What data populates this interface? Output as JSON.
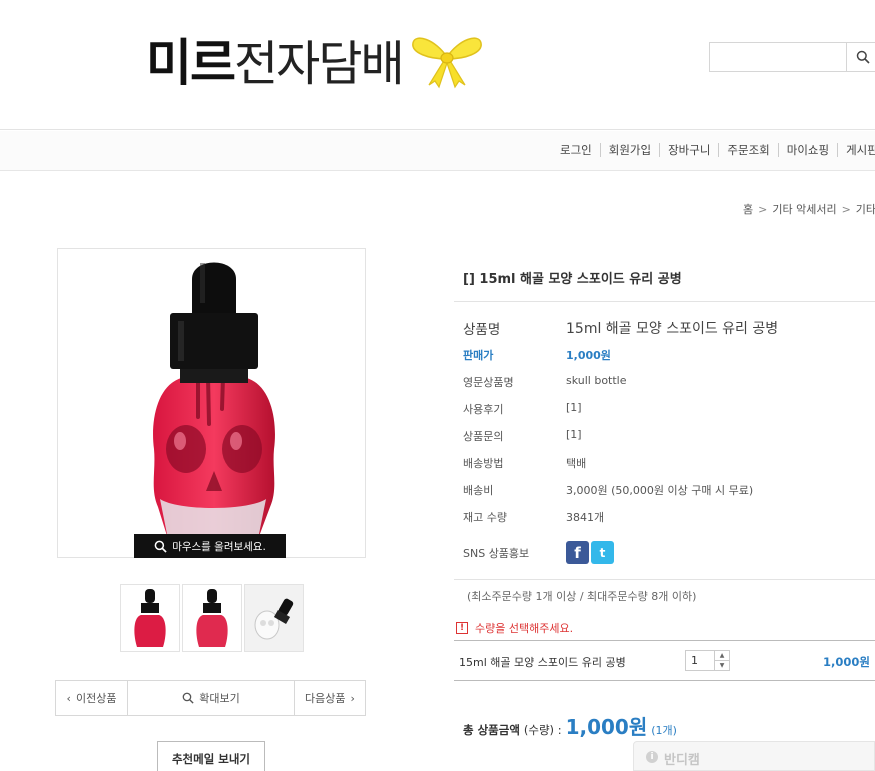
{
  "header": {
    "logo_bold": "미르",
    "logo_light": "전자담배",
    "search_placeholder": ""
  },
  "topnav": {
    "items": [
      "로그인",
      "회원가입",
      "장바구니",
      "주문조회",
      "마이쇼핑",
      "게시판"
    ]
  },
  "breadcrumb": [
    "홈",
    "기타 악세서리",
    "기타"
  ],
  "gallery": {
    "zoom_tip": "마우스를 올려보세요.",
    "prev_label": "이전상품",
    "zoom_label": "확대보기",
    "next_label": "다음상품",
    "recommend_label": "추천메일 보내기"
  },
  "product": {
    "title": "[] 15ml 해골 모양 스포이드 유리 공병",
    "name_label": "상품명",
    "name": "15ml 해골 모양 스포이드 유리 공병",
    "price_label": "판매가",
    "price": "1,000원",
    "eng_label": "영문상품명",
    "eng_name": "skull bottle",
    "review_label": "사용후기",
    "review_count": "[1]",
    "qna_label": "상품문의",
    "qna_count": "[1]",
    "ship_method_label": "배송방법",
    "ship_method": "택배",
    "ship_fee_label": "배송비",
    "ship_fee": "3,000원 (50,000원 이상 구매 시 무료)",
    "stock_label": "재고 수량",
    "stock": "3841개",
    "sns_label": "SNS 상품홍보"
  },
  "order": {
    "minmax": "(최소주문수량 1개 이상 / 최대주문수량 8개 이하)",
    "warning": "수량을 선택해주세요.",
    "option_name": "15ml 해골 모양 스포이드 유리 공병",
    "quantity": "1",
    "option_price": "1,000원",
    "total_label": "총 상품금액",
    "total_suffix": "(수량) :",
    "total_amount": "1,000원",
    "total_count": "(1개)"
  },
  "widget": {
    "label": "반디캠"
  },
  "colors": {
    "accent": "#2a7ec3",
    "warning": "#dd3333",
    "facebook": "#3b5998",
    "twitter": "#33b8ea"
  }
}
